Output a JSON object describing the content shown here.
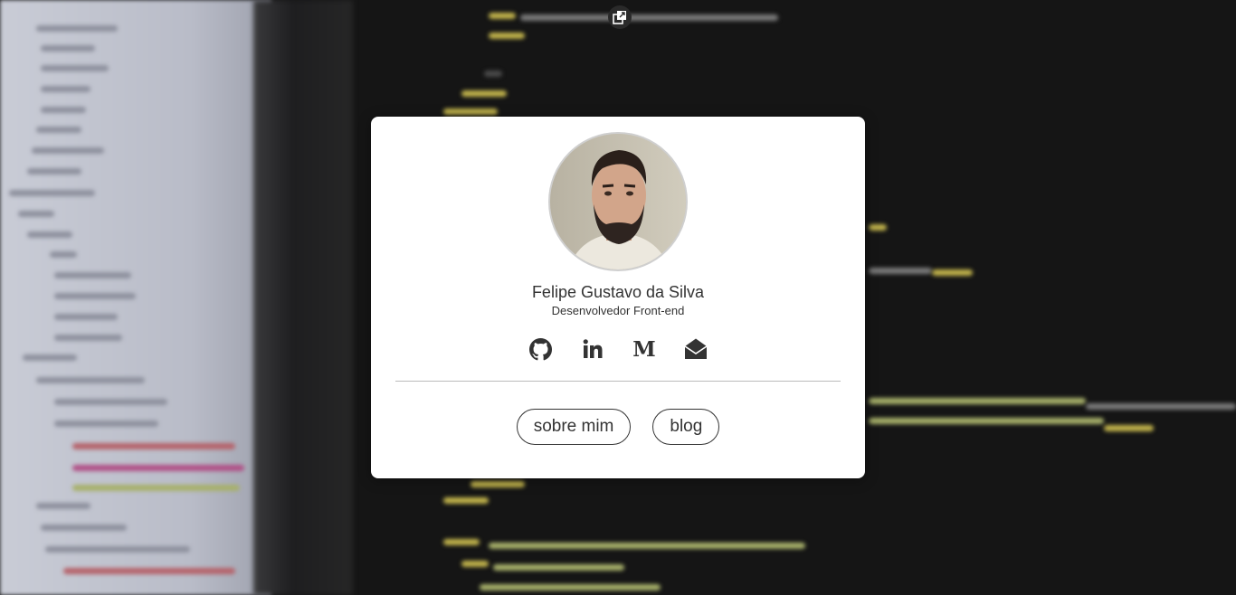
{
  "profile": {
    "name": "Felipe Gustavo da Silva",
    "role": "Desenvolvedor Front-end"
  },
  "social_links": [
    {
      "icon": "github-icon",
      "label": "GitHub"
    },
    {
      "icon": "linkedin-icon",
      "label": "LinkedIn"
    },
    {
      "icon": "medium-icon",
      "label": "Medium"
    },
    {
      "icon": "email-icon",
      "label": "Email"
    }
  ],
  "buttons": {
    "about": "sobre mim",
    "blog": "blog"
  },
  "colors": {
    "card_bg": "#ffffff",
    "text": "#333333",
    "background": "#151515"
  }
}
